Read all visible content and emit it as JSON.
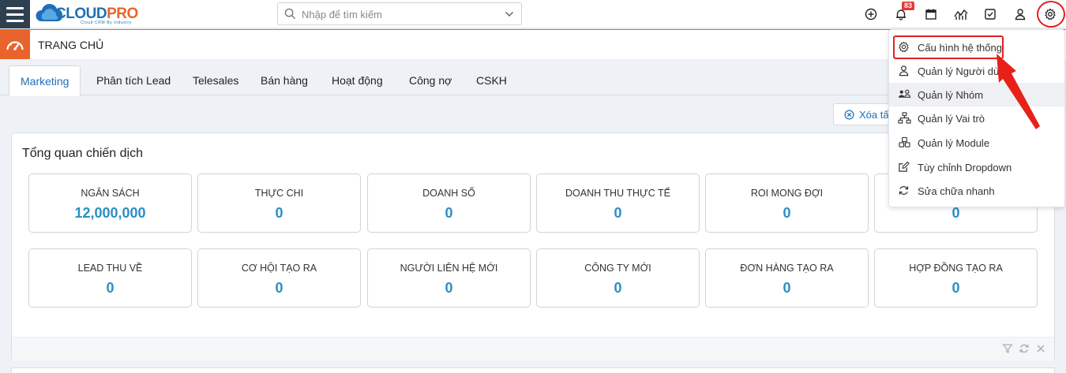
{
  "header": {
    "logo_cloud": "CLOUD",
    "logo_pro": "PRO",
    "logo_tagline": "Cloud CRM By Industry",
    "search_placeholder": "Nhập để tìm kiếm",
    "notification_count": "83"
  },
  "page": {
    "title": "TRANG CHỦ"
  },
  "tabs": [
    {
      "label": "Marketing",
      "active": true
    },
    {
      "label": "Phân tích Lead"
    },
    {
      "label": "Telesales"
    },
    {
      "label": "Bán hàng"
    },
    {
      "label": "Hoạt động"
    },
    {
      "label": "Công nợ"
    },
    {
      "label": "CSKH"
    }
  ],
  "toolbar": {
    "clear_label": "Xóa tấ"
  },
  "widget": {
    "title": "Tổng quan chiến dịch",
    "cards": [
      {
        "label": "NGÂN SÁCH",
        "value": "12,000,000"
      },
      {
        "label": "THỰC CHI",
        "value": "0"
      },
      {
        "label": "DOANH SỐ",
        "value": "0"
      },
      {
        "label": "DOANH THU THỰC TẾ",
        "value": "0"
      },
      {
        "label": "ROI MONG ĐỢI",
        "value": "0"
      },
      {
        "label": "",
        "value": "0"
      },
      {
        "label": "LEAD THU VỀ",
        "value": "0"
      },
      {
        "label": "CƠ HỘI TẠO RA",
        "value": "0"
      },
      {
        "label": "NGƯỜI LIÊN HỆ MỚI",
        "value": "0"
      },
      {
        "label": "CÔNG TY MỚI",
        "value": "0"
      },
      {
        "label": "ĐƠN HÀNG TẠO RA",
        "value": "0"
      },
      {
        "label": "HỢP ĐỒNG TẠO RA",
        "value": "0"
      }
    ]
  },
  "settings_menu": {
    "items": [
      {
        "label": "Cấu hình hệ thống",
        "icon": "gear-icon"
      },
      {
        "label": "Quản lý Người dùng",
        "icon": "user-icon"
      },
      {
        "label": "Quản lý Nhóm",
        "icon": "group-icon"
      },
      {
        "label": "Quản lý Vai trò",
        "icon": "hierarchy-icon"
      },
      {
        "label": "Quản lý Module",
        "icon": "cubes-icon"
      },
      {
        "label": "Tùy chỉnh Dropdown",
        "icon": "edit-icon"
      },
      {
        "label": "Sửa chữa nhanh",
        "icon": "refresh-icon"
      }
    ]
  },
  "colors": {
    "accent_blue": "#1e6fb8",
    "value_blue": "#2a8fc4",
    "brand_orange": "#e8642c",
    "sidebar_dark": "#2f4050",
    "highlight_red": "#e02020"
  }
}
